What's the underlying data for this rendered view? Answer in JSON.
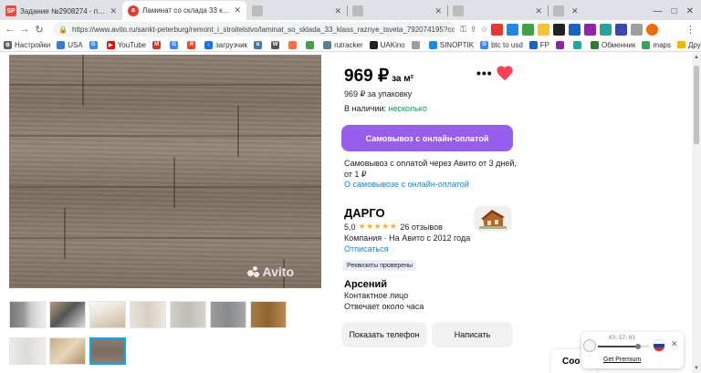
{
  "browser": {
    "tabs": [
      {
        "title": "Задание №2908274 - просмотр з",
        "favicon": "SP",
        "favicon_color": "#e94c3d",
        "active": false
      },
      {
        "title": "Ламинат со склада 33 класс разн",
        "favicon": "avito",
        "favicon_color": "#e53935",
        "active": true
      },
      {
        "title": "",
        "favicon": "",
        "favicon_color": "#bbbbbb",
        "active": false
      },
      {
        "title": "",
        "favicon": "",
        "favicon_color": "#bbbbbb",
        "active": false
      },
      {
        "title": "",
        "favicon": "",
        "favicon_color": "#bbbbbb",
        "active": false
      },
      {
        "title": "",
        "favicon": "",
        "favicon_color": "#bbbbbb",
        "active": false
      }
    ],
    "url": "https://www.avito.ru/sankt-peterburg/remont_i_stroitelstvo/laminat_so_sklada_33_klass_raznye_tsveta_792074195?context=H...",
    "bookmarks": [
      {
        "label": "Настройки",
        "icon": "gear-icon",
        "color": "#5f6368"
      },
      {
        "label": "USA",
        "icon": "flag-icon",
        "color": "#3c78d8"
      },
      {
        "label": "",
        "icon": "g-icon",
        "color": "#4285f4"
      },
      {
        "label": "YouTube",
        "icon": "youtube-icon",
        "color": "#ff0000"
      },
      {
        "label": "",
        "icon": "gmail-icon",
        "color": "#d93025"
      },
      {
        "label": "",
        "icon": "g-icon",
        "color": "#4285f4"
      },
      {
        "label": "",
        "icon": "yandex-icon",
        "color": "#fc3f1d"
      },
      {
        "label": "загрузчик",
        "icon": "download-icon",
        "color": "#1a73e8"
      },
      {
        "label": "",
        "icon": "vk-icon",
        "color": "#4a76a8"
      },
      {
        "label": "",
        "icon": "wiki-icon",
        "color": "#555555"
      },
      {
        "label": "",
        "icon": "app-icon",
        "color": "#ff7043"
      },
      {
        "label": "",
        "icon": "app-icon",
        "color": "#43a047"
      },
      {
        "label": "rutracker",
        "icon": "rutracker-icon",
        "color": "#607d8b"
      },
      {
        "label": "UAKino",
        "icon": "uakino-icon",
        "color": "#222222"
      },
      {
        "label": "",
        "icon": "app-icon",
        "color": "#9e9e9e"
      },
      {
        "label": "SINOPTIK",
        "icon": "weather-icon",
        "color": "#1e88e5"
      },
      {
        "label": "btc to usd",
        "icon": "g-icon",
        "color": "#4285f4"
      },
      {
        "label": "FP",
        "icon": "fp-icon",
        "color": "#1565c0"
      },
      {
        "label": "",
        "icon": "app-icon",
        "color": "#8e24aa"
      },
      {
        "label": "",
        "icon": "app-icon",
        "color": "#26a69a"
      },
      {
        "label": "Обменник",
        "icon": "exchange-icon",
        "color": "#2e7d32"
      },
      {
        "label": "maps",
        "icon": "maps-icon",
        "color": "#34a853"
      }
    ],
    "other_bookmarks": "Другие закладки"
  },
  "listing": {
    "watermark": "Avito",
    "price": "969 ₽",
    "price_unit": "за м²",
    "pack_price": "969 ₽ за упаковку",
    "availability_label": "В наличии:",
    "availability_value": "несколько",
    "cta_label": "Самовывоз с онлайн-оплатой",
    "pickup_desc": "Самовывоз с оплатой через Авито от 3 дней, от 1 ₽",
    "pickup_link": "О самовывозе с онлайн-оплатой",
    "seller": {
      "name": "ДАРГО",
      "rating": "5,0",
      "stars": "★★★★★",
      "reviews": "26 отзывов",
      "company": "Компания · На Авито с 2012 года",
      "unsubscribe": "Отписаться",
      "verified": "Реквизиты проверены"
    },
    "contact": {
      "name": "Арсений",
      "role": "Контактное лицо",
      "response": "Отвечает около часа"
    },
    "show_phone": "Показать телефон",
    "write": "Написать",
    "heart_color": "#ff4053",
    "thumbnails_selected_index": 9
  },
  "widget": {
    "time": "03:57:03",
    "progress": 0.78,
    "link": "Get Premium"
  },
  "cookie": {
    "label": "Coo"
  }
}
